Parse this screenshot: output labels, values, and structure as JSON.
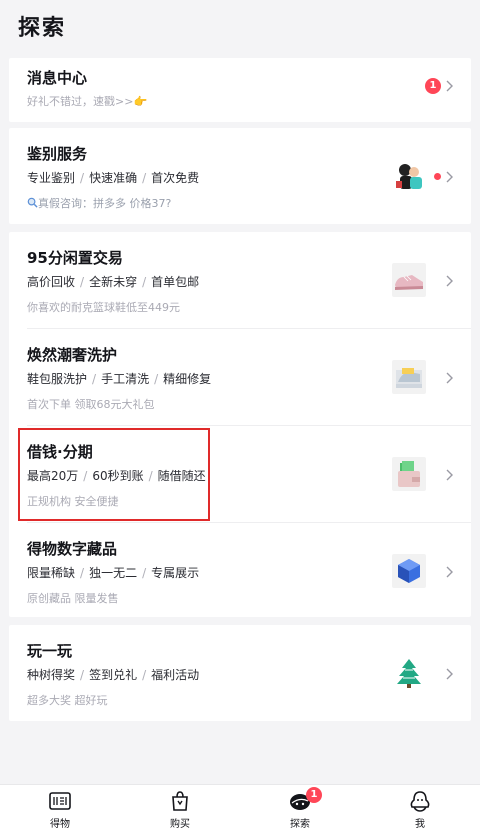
{
  "header": {
    "title": "探索"
  },
  "message_center": {
    "title": "消息中心",
    "subtitle": "好礼不错过，速戳>>",
    "emoji": "👉",
    "badge": "1"
  },
  "authentication": {
    "title": "鉴别服务",
    "tags": [
      "专业鉴别",
      "快速准确",
      "首次免费"
    ],
    "subtitle": "真假咨询：拼多多 价格37?"
  },
  "services": [
    {
      "title": "95分闲置交易",
      "tags": [
        "高价回收",
        "全新未穿",
        "首单包邮"
      ],
      "subtitle": "你喜欢的耐克篮球鞋低至449元"
    },
    {
      "title": "焕然潮奢洗护",
      "tags": [
        "鞋包服洗护",
        "手工清洗",
        "精细修复"
      ],
      "subtitle": "首次下单 领取68元大礼包"
    },
    {
      "title": "借钱·分期",
      "tags": [
        "最高20万",
        "60秒到账",
        "随借随还"
      ],
      "subtitle": "正规机构 安全便捷"
    },
    {
      "title": "得物数字藏品",
      "tags": [
        "限量稀缺",
        "独一无二",
        "专属展示"
      ],
      "subtitle": "原创藏品 限量发售"
    }
  ],
  "play": {
    "title": "玩一玩",
    "tags": [
      "种树得奖",
      "签到兑礼",
      "福利活动"
    ],
    "subtitle": "超多大奖 超好玩"
  },
  "tabbar": {
    "tabs": [
      {
        "label": "得物",
        "icon": "dewu-logo-icon"
      },
      {
        "label": "购买",
        "icon": "shopping-bag-icon"
      },
      {
        "label": "探索",
        "icon": "explore-icon",
        "badge": "1"
      },
      {
        "label": "我",
        "icon": "profile-icon"
      }
    ]
  },
  "colors": {
    "accent_red": "#ff4657",
    "background": "#f4f4f6",
    "highlight_box": "#e02a2a"
  }
}
